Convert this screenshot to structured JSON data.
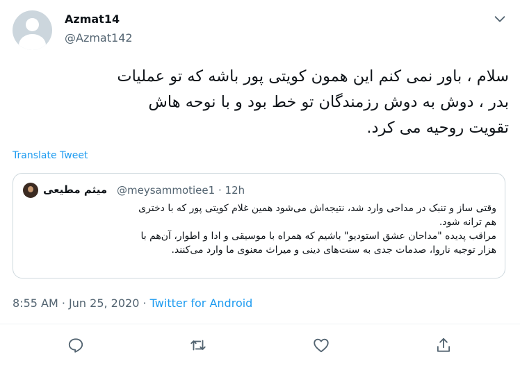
{
  "author": {
    "display_name": "Azmat14",
    "handle": "@Azmat142"
  },
  "tweet": {
    "text": "سلام ، باور نمی کنم این همون کویتی پور باشه که تو عملیات\nبدر ، دوش به دوش رزمندگان تو خط بود و با نوحه هاش\nتقویت روحیه می کرد.",
    "translate_label": "Translate Tweet"
  },
  "quoted_tweet": {
    "display_name": "میثم مطیعی",
    "handle": "@meysammotiee1",
    "separator": "·",
    "time": "12h",
    "text": "وقتی ساز و تنبک در مداحی وارد شد، نتیجه‌اش می‌شود همین غلام کویتی پور که با دختری\nهم ترانه شود.\nمراقب پدیده \"مداحان عشق استودیو\" باشیم که همراه با موسیقی و ادا و اطوار، آن‌هم با\nهزار توجیه ناروا، صدمات جدی به سنت‌های دینی و میراث معنوی ما وارد می‌کنند."
  },
  "meta": {
    "time": "8:55 AM",
    "date": "Jun 25, 2020",
    "separator": "·",
    "source": "Twitter for Android"
  },
  "icons": {
    "more": "chevron-down-icon",
    "reply": "reply-icon",
    "retweet": "retweet-icon",
    "like": "heart-icon",
    "share": "share-icon"
  },
  "colors": {
    "accent": "#1d9bf0",
    "secondary_text": "#536471",
    "border": "#cfd9de"
  }
}
